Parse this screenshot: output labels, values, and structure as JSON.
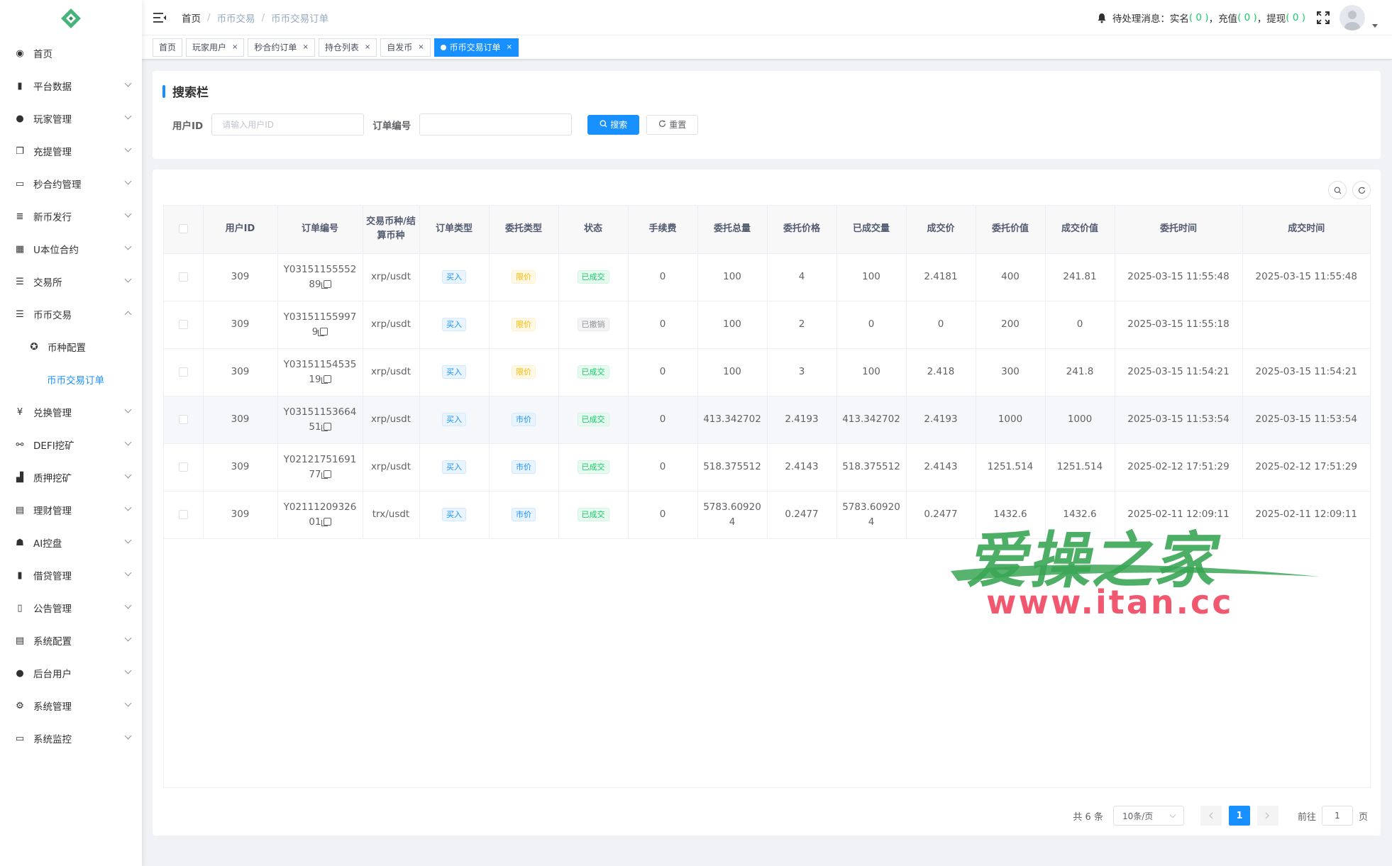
{
  "sidebar": {
    "items": [
      {
        "label": "首页",
        "icon": "dashboard-icon",
        "glyph": "◉",
        "arrow": false
      },
      {
        "label": "平台数据",
        "icon": "book-icon",
        "glyph": "▮",
        "arrow": true
      },
      {
        "label": "玩家管理",
        "icon": "user-icon",
        "glyph": "●",
        "arrow": true
      },
      {
        "label": "充提管理",
        "icon": "documents-icon",
        "glyph": "❐",
        "arrow": true
      },
      {
        "label": "秒合约管理",
        "icon": "monitor-icon",
        "glyph": "▭",
        "arrow": true
      },
      {
        "label": "新币发行",
        "icon": "list-icon",
        "glyph": "≣",
        "arrow": true
      },
      {
        "label": "U本位合约",
        "icon": "grid-icon",
        "glyph": "▦",
        "arrow": true
      },
      {
        "label": "交易所",
        "icon": "tree-list-icon",
        "glyph": "☰",
        "arrow": true
      },
      {
        "label": "币币交易",
        "icon": "list-icon",
        "glyph": "☰",
        "arrow": true,
        "open": true
      }
    ],
    "sub_items": [
      {
        "label": "币种配置",
        "icon": "gear-circle-icon",
        "glyph": "✪"
      },
      {
        "label": "币币交易订单",
        "active": true
      }
    ],
    "items_after": [
      {
        "label": "兑换管理",
        "icon": "yen-icon",
        "glyph": "¥",
        "arrow": true
      },
      {
        "label": "DEFI挖矿",
        "icon": "share-icon",
        "glyph": "⚯",
        "arrow": true
      },
      {
        "label": "质押挖矿",
        "icon": "bar-chart-icon",
        "glyph": "▟",
        "arrow": true
      },
      {
        "label": "理财管理",
        "icon": "document-icon",
        "glyph": "▤",
        "arrow": true
      },
      {
        "label": "AI控盘",
        "icon": "robot-icon",
        "glyph": "☗",
        "arrow": true
      },
      {
        "label": "借贷管理",
        "icon": "book-icon",
        "glyph": "▮",
        "arrow": true
      },
      {
        "label": "公告管理",
        "icon": "open-book-icon",
        "glyph": "▯",
        "arrow": true
      },
      {
        "label": "系统配置",
        "icon": "document-icon",
        "glyph": "▤",
        "arrow": true
      },
      {
        "label": "后台用户",
        "icon": "users-icon",
        "glyph": "●",
        "arrow": true
      },
      {
        "label": "系统管理",
        "icon": "gear-icon",
        "glyph": "⚙",
        "arrow": true
      },
      {
        "label": "系统监控",
        "icon": "monitor-icon",
        "glyph": "▭",
        "arrow": true
      }
    ]
  },
  "header": {
    "breadcrumb": [
      "首页",
      "币币交易",
      "币币交易订单"
    ],
    "notice_prefix": "待处理消息：",
    "notice_items": [
      {
        "label": "实名",
        "count": "( 0 )"
      },
      {
        "label": "充值",
        "count": "( 0 )"
      },
      {
        "label": "提现",
        "count": "( 0 )"
      }
    ]
  },
  "tags": [
    {
      "label": "首页",
      "closable": false
    },
    {
      "label": "玩家用户",
      "closable": true
    },
    {
      "label": "秒合约订单",
      "closable": true
    },
    {
      "label": "持仓列表",
      "closable": true
    },
    {
      "label": "自发币",
      "closable": true
    },
    {
      "label": "币币交易订单",
      "closable": true,
      "active": true
    }
  ],
  "search": {
    "title": "搜索栏",
    "user_id_label": "用户ID",
    "user_id_placeholder": "请输入用户ID",
    "order_no_label": "订单编号",
    "order_no_placeholder": "",
    "search_btn": "搜索",
    "reset_btn": "重置"
  },
  "table": {
    "columns": [
      "",
      "用户ID",
      "订单编号",
      "交易币种/结算币种",
      "订单类型",
      "委托类型",
      "状态",
      "手续费",
      "委托总量",
      "委托价格",
      "已成交量",
      "成交价",
      "委托价值",
      "成交价值",
      "委托时间",
      "成交时间"
    ],
    "rows": [
      {
        "user_id": "309",
        "order_no_a": "Y03151155552",
        "order_no_b": "89",
        "pair": "xrp/usdt",
        "order_type": "买入",
        "entrust_type": "限价",
        "entrust_color": "orange",
        "status": "已成交",
        "status_color": "green",
        "fee": "0",
        "total": "100",
        "price": "4",
        "filled": "100",
        "deal_price": "2.4181",
        "entrust_value": "400",
        "deal_value": "241.81",
        "entrust_time": "2025-03-15 11:55:48",
        "deal_time": "2025-03-15 11:55:48"
      },
      {
        "user_id": "309",
        "order_no_a": "Y03151155997",
        "order_no_b": "9",
        "pair": "xrp/usdt",
        "order_type": "买入",
        "entrust_type": "限价",
        "entrust_color": "orange",
        "status": "已撤销",
        "status_color": "gray",
        "fee": "0",
        "total": "100",
        "price": "2",
        "filled": "0",
        "deal_price": "0",
        "entrust_value": "200",
        "deal_value": "0",
        "entrust_time": "2025-03-15 11:55:18",
        "deal_time": ""
      },
      {
        "user_id": "309",
        "order_no_a": "Y03151154535",
        "order_no_b": "19",
        "pair": "xrp/usdt",
        "order_type": "买入",
        "entrust_type": "限价",
        "entrust_color": "orange",
        "status": "已成交",
        "status_color": "green",
        "fee": "0",
        "total": "100",
        "price": "3",
        "filled": "100",
        "deal_price": "2.418",
        "entrust_value": "300",
        "deal_value": "241.8",
        "entrust_time": "2025-03-15 11:54:21",
        "deal_time": "2025-03-15 11:54:21"
      },
      {
        "user_id": "309",
        "order_no_a": "Y03151153664",
        "order_no_b": "51",
        "pair": "xrp/usdt",
        "order_type": "买入",
        "entrust_type": "市价",
        "entrust_color": "blue",
        "status": "已成交",
        "status_color": "green",
        "fee": "0",
        "total": "413.342702",
        "price": "2.4193",
        "filled": "413.342702",
        "deal_price": "2.4193",
        "entrust_value": "1000",
        "deal_value": "1000",
        "entrust_time": "2025-03-15 11:53:54",
        "deal_time": "2025-03-15 11:53:54",
        "highlight": true
      },
      {
        "user_id": "309",
        "order_no_a": "Y02121751691",
        "order_no_b": "77",
        "pair": "xrp/usdt",
        "order_type": "买入",
        "entrust_type": "市价",
        "entrust_color": "blue",
        "status": "已成交",
        "status_color": "green",
        "fee": "0",
        "total": "518.375512",
        "price": "2.4143",
        "filled": "518.375512",
        "deal_price": "2.4143",
        "entrust_value": "1251.514",
        "deal_value": "1251.514",
        "entrust_time": "2025-02-12 17:51:29",
        "deal_time": "2025-02-12 17:51:29"
      },
      {
        "user_id": "309",
        "order_no_a": "Y02111209326",
        "order_no_b": "01",
        "pair": "trx/usdt",
        "order_type": "买入",
        "entrust_type": "市价",
        "entrust_color": "blue",
        "status": "已成交",
        "status_color": "green",
        "fee": "0",
        "total": "5783.60920\n4",
        "price": "0.2477",
        "filled": "5783.60920\n4",
        "deal_price": "0.2477",
        "entrust_value": "1432.6",
        "deal_value": "1432.6",
        "entrust_time": "2025-02-11 12:09:11",
        "deal_time": "2025-02-11 12:09:11"
      }
    ]
  },
  "pagination": {
    "total": "共 6 条",
    "page_size": "10条/页",
    "current": "1",
    "goto_label": "前往",
    "goto_value": "1",
    "page_suffix": "页"
  },
  "watermark": {
    "title": "爱操之家",
    "url": "www.itan.cc"
  },
  "colors": {
    "primary": "#1890ff",
    "success": "#13ce66",
    "warning": "#ffba00",
    "watermark_green": "#3aa655",
    "watermark_red": "#ef3b56"
  }
}
